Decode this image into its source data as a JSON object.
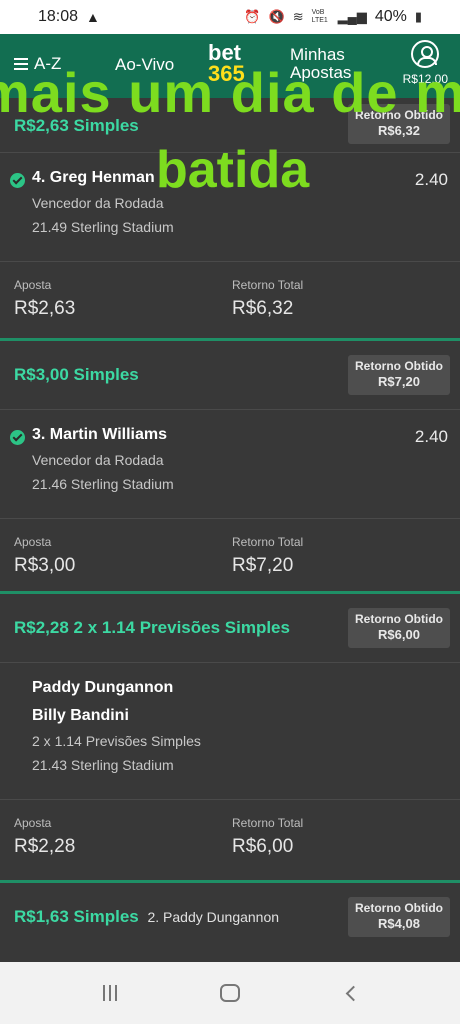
{
  "status_bar": {
    "time": "18:08",
    "battery": "40%",
    "signal_text": "VoB LTE1"
  },
  "header": {
    "menu_label": "A-Z",
    "live_label": "Ao-Vivo",
    "logo_top": "bet",
    "logo_bottom": "365",
    "my_bets_label_1": "Minhas",
    "my_bets_label_2": "Apostas",
    "balance": "R$12,00"
  },
  "overlay": {
    "line1": "mais um dia de m",
    "line2": "batida"
  },
  "bets": [
    {
      "title": "R$2,63 Simples",
      "cashout_label": "Retorno Obtido",
      "cashout_value": "R$6,32",
      "selection": "4. Greg Henman",
      "odds": "2.40",
      "market": "Vencedor da Rodada",
      "event": "21.49 Sterling Stadium",
      "stake_label": "Aposta",
      "stake": "R$2,63",
      "return_label": "Retorno Total",
      "return": "R$6,32"
    },
    {
      "title": "R$3,00 Simples",
      "cashout_label": "Retorno Obtido",
      "cashout_value": "R$7,20",
      "selection": "3. Martin Williams",
      "odds": "2.40",
      "market": "Vencedor da Rodada",
      "event": "21.46 Sterling Stadium",
      "stake_label": "Aposta",
      "stake": "R$3,00",
      "return_label": "Retorno Total",
      "return": "R$7,20"
    },
    {
      "title": "R$2,28 2 x 1.14 Previsões Simples",
      "cashout_label": "Retorno Obtido",
      "cashout_value": "R$6,00",
      "selection_1": "Paddy Dungannon",
      "selection_2": "Billy Bandini",
      "market": "2 x 1.14 Previsões Simples",
      "event": "21.43 Sterling Stadium",
      "stake_label": "Aposta",
      "stake": "R$2,28",
      "return_label": "Retorno Total",
      "return": "R$6,00"
    },
    {
      "title": "R$1,63 Simples",
      "subtitle": "2. Paddy Dungannon",
      "cashout_label": "Retorno Obtido",
      "cashout_value": "R$4,08"
    }
  ],
  "colors": {
    "header_green": "#126e51",
    "accent_green": "#3cd9a3",
    "overlay_green": "#7ddc1f",
    "logo_yellow": "#ffdf1b"
  }
}
